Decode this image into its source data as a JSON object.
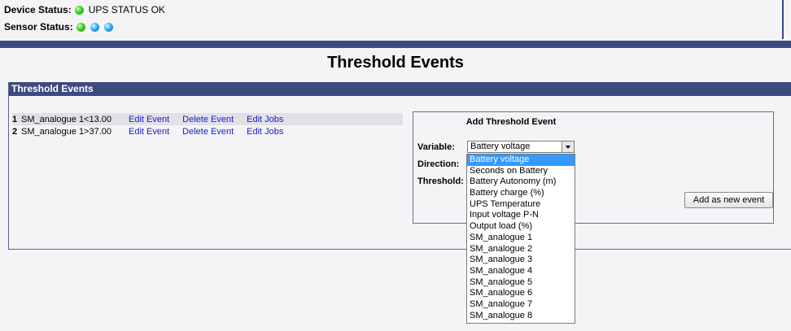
{
  "device_status": {
    "label": "Device Status:",
    "text": "UPS STATUS OK"
  },
  "sensor_status": {
    "label": "Sensor Status:"
  },
  "page_title": "Threshold Events",
  "panel": {
    "header": "Threshold Events"
  },
  "events": [
    {
      "num": "1",
      "name": "SM_analogue 1<13.00",
      "edit_event": "Edit Event",
      "delete_event": "Delete Event",
      "edit_jobs": "Edit Jobs"
    },
    {
      "num": "2",
      "name": "SM_analogue 1>37.00",
      "edit_event": "Edit Event",
      "delete_event": "Delete Event",
      "edit_jobs": "Edit Jobs"
    }
  ],
  "add_form": {
    "title": "Add Threshold Event",
    "variable_label": "Variable:",
    "direction_label": "Direction:",
    "threshold_label": "Threshold:",
    "selected_variable": "Battery voltage",
    "button": "Add as new event"
  },
  "dropdown_options": [
    "Battery voltage",
    "Seconds on Battery",
    "Battery Autonomy (m)",
    "Battery charge (%)",
    "UPS Temperature",
    "Input voltage P-N",
    "Output load (%)",
    "SM_analogue 1",
    "SM_analogue 2",
    "SM_analogue 3",
    "SM_analogue 4",
    "SM_analogue 5",
    "SM_analogue 6",
    "SM_analogue 7",
    "SM_analogue 8"
  ],
  "colors": {
    "header_bar": "#3b4a80",
    "link": "#1a1ad0",
    "selected_option": "#3399ff"
  },
  "icons": {
    "device_status": "green-status-icon",
    "sensor_status": [
      "green-status-icon",
      "blue-status-icon",
      "blue-status-icon"
    ]
  }
}
